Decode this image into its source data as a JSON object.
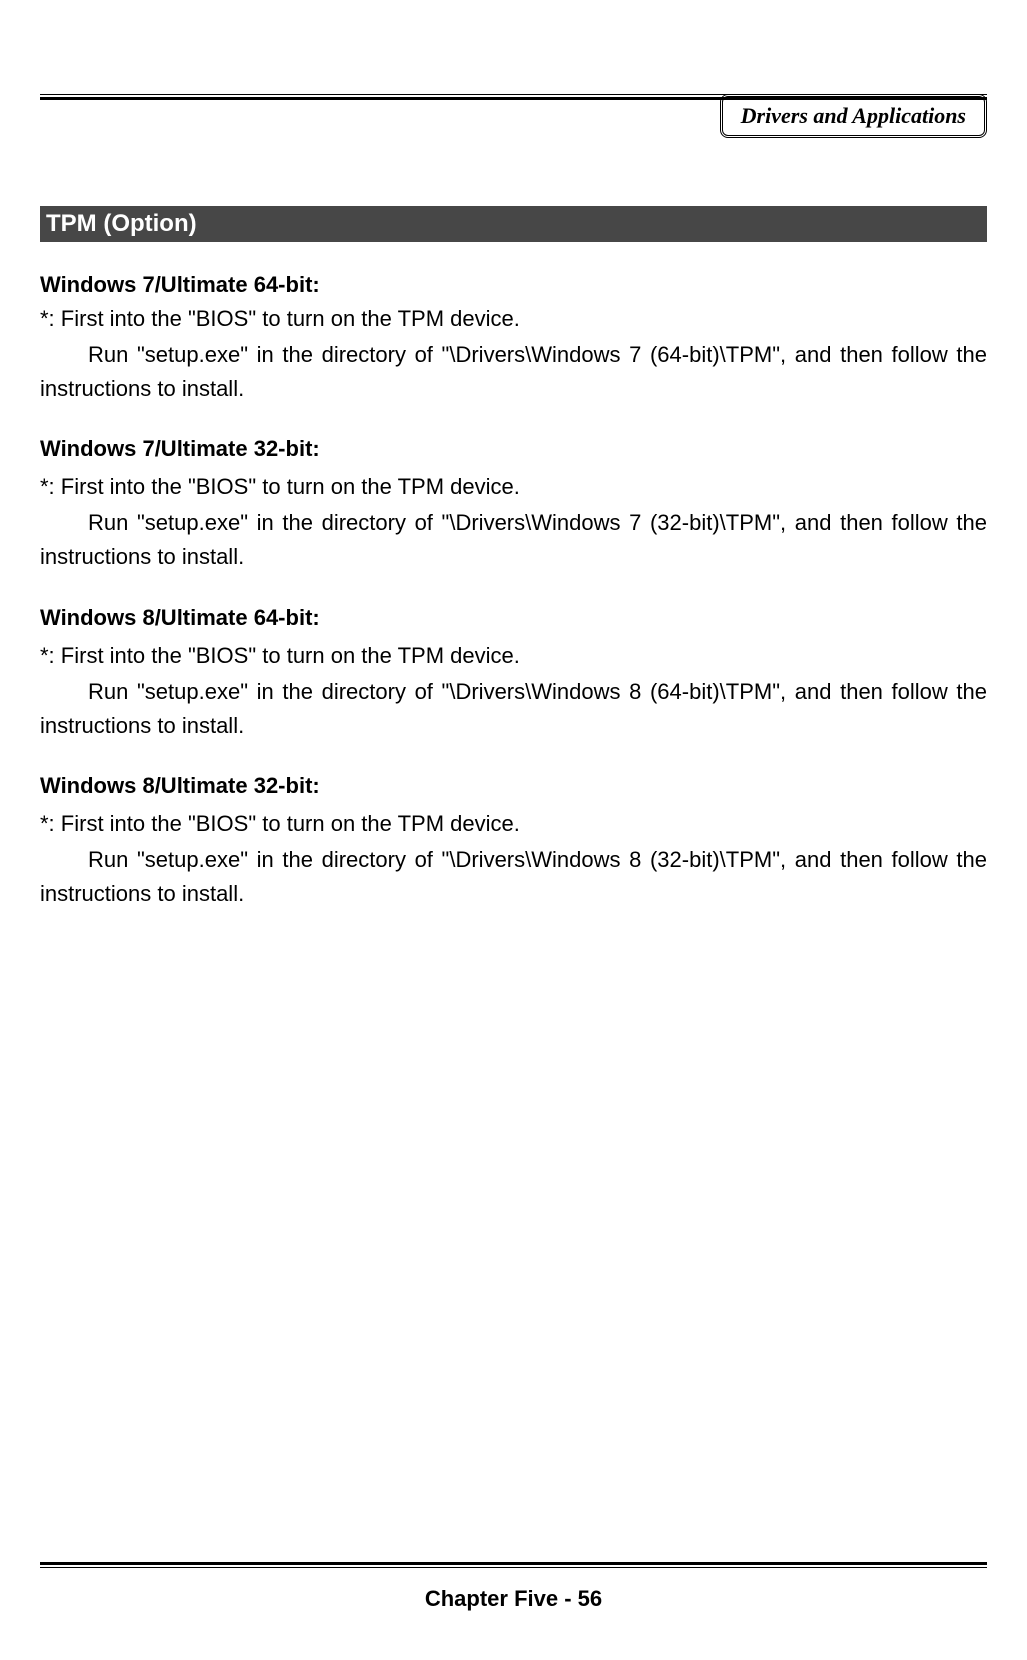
{
  "header": {
    "badge": "Drivers and Applications"
  },
  "section": {
    "title": "TPM (Option)"
  },
  "os": [
    {
      "title": "Windows 7/Ultimate 64-bit:",
      "bios": "*: First into the \"BIOS\" to turn on the TPM device.",
      "run": "Run \"setup.exe\" in the directory of \"\\Drivers\\Windows 7 (64-bit)\\TPM\", and then follow the instructions to install."
    },
    {
      "title": "Windows 7/Ultimate 32-bit:",
      "bios": "*: First into the \"BIOS\" to turn on the TPM device.",
      "run": "Run \"setup.exe\" in the directory of \"\\Drivers\\Windows 7 (32-bit)\\TPM\", and then follow the instructions to install."
    },
    {
      "title": "Windows 8/Ultimate 64-bit:",
      "bios": "*: First into the \"BIOS\" to turn on the TPM device.",
      "run": "Run \"setup.exe\" in the directory of \"\\Drivers\\Windows 8 (64-bit)\\TPM\", and then follow the instructions to install."
    },
    {
      "title": "Windows 8/Ultimate 32-bit:",
      "bios": "*: First into the \"BIOS\" to turn on the TPM device.",
      "run": "Run \"setup.exe\" in the directory of \"\\Drivers\\Windows 8 (32-bit)\\TPM\", and then follow the instructions to install."
    }
  ],
  "footer": {
    "text": "Chapter Five - 56"
  }
}
